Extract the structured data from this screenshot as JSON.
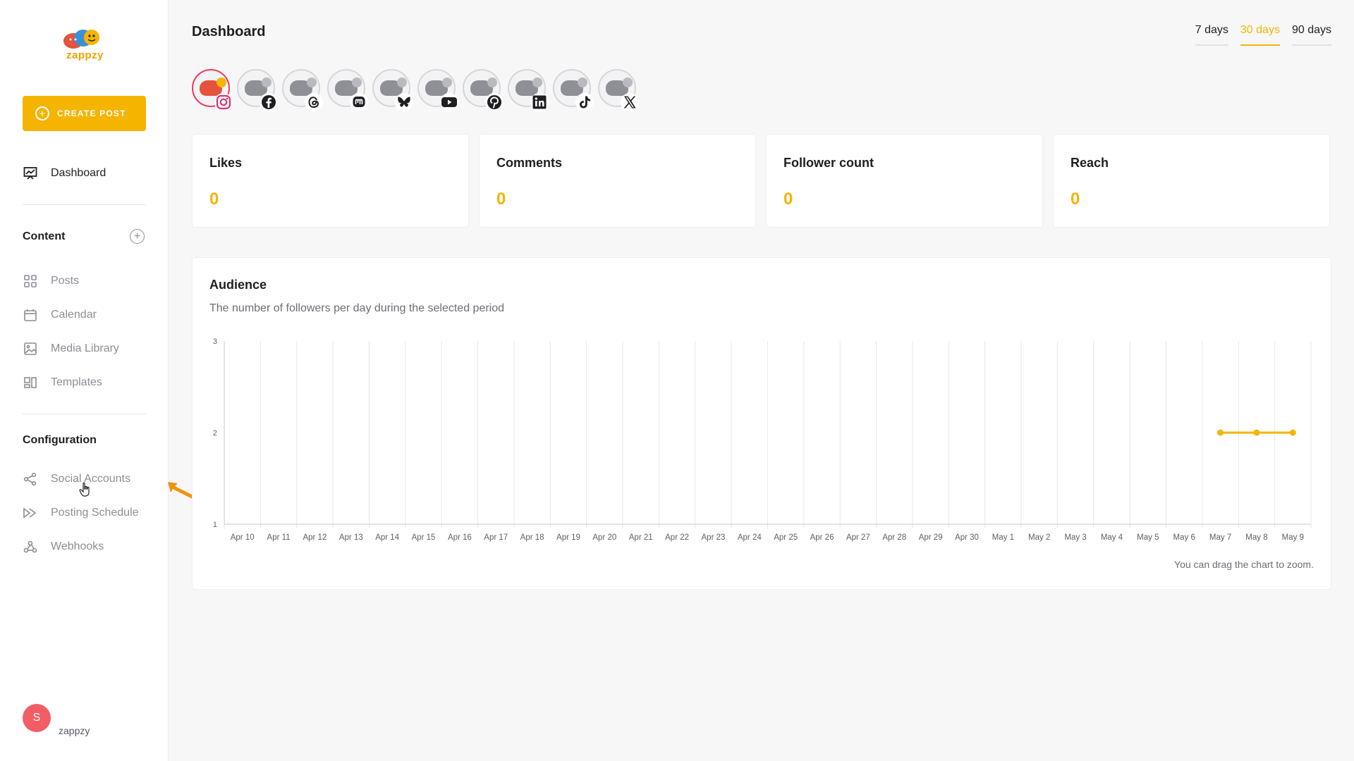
{
  "brand": {
    "name": "zappzy",
    "accent": "#f5b400"
  },
  "sidebar": {
    "create_label": "CREATE POST",
    "dashboard_label": "Dashboard",
    "content_title": "Content",
    "content_items": [
      {
        "label": "Posts",
        "icon": "grid-icon"
      },
      {
        "label": "Calendar",
        "icon": "calendar-icon"
      },
      {
        "label": "Media Library",
        "icon": "image-icon"
      },
      {
        "label": "Templates",
        "icon": "templates-icon"
      }
    ],
    "config_title": "Configuration",
    "config_items": [
      {
        "label": "Social Accounts",
        "icon": "share-icon"
      },
      {
        "label": "Posting Schedule",
        "icon": "schedule-icon"
      },
      {
        "label": "Webhooks",
        "icon": "webhook-icon"
      }
    ],
    "user": {
      "initial": "S",
      "name": "zappzy"
    }
  },
  "header": {
    "title": "Dashboard",
    "ranges": [
      "7 days",
      "30 days",
      "90 days"
    ],
    "selected_range": "30 days"
  },
  "accounts": [
    {
      "network": "instagram-icon",
      "active": true
    },
    {
      "network": "facebook-icon",
      "active": false
    },
    {
      "network": "threads-icon",
      "active": false
    },
    {
      "network": "mastodon-icon",
      "active": false
    },
    {
      "network": "bluesky-icon",
      "active": false
    },
    {
      "network": "youtube-icon",
      "active": false
    },
    {
      "network": "pinterest-icon",
      "active": false
    },
    {
      "network": "linkedin-icon",
      "active": false
    },
    {
      "network": "tiktok-icon",
      "active": false
    },
    {
      "network": "x-icon",
      "active": false
    }
  ],
  "stats": [
    {
      "title": "Likes",
      "value": "0"
    },
    {
      "title": "Comments",
      "value": "0"
    },
    {
      "title": "Follower count",
      "value": "0"
    },
    {
      "title": "Reach",
      "value": "0"
    }
  ],
  "audience": {
    "title": "Audience",
    "subtitle": "The number of followers per day during the selected period",
    "hint": "You can drag the chart to zoom."
  },
  "chart_data": {
    "type": "line",
    "title": "Audience",
    "categories": [
      "Apr 10",
      "Apr 11",
      "Apr 12",
      "Apr 13",
      "Apr 14",
      "Apr 15",
      "Apr 16",
      "Apr 17",
      "Apr 18",
      "Apr 19",
      "Apr 20",
      "Apr 21",
      "Apr 22",
      "Apr 23",
      "Apr 24",
      "Apr 25",
      "Apr 26",
      "Apr 27",
      "Apr 28",
      "Apr 29",
      "Apr 30",
      "May 1",
      "May 2",
      "May 3",
      "May 4",
      "May 5",
      "May 6",
      "May 7",
      "May 8",
      "May 9"
    ],
    "series": [
      {
        "values": [
          null,
          null,
          null,
          null,
          null,
          null,
          null,
          null,
          null,
          null,
          null,
          null,
          null,
          null,
          null,
          null,
          null,
          null,
          null,
          null,
          null,
          null,
          null,
          null,
          null,
          null,
          null,
          2,
          2,
          2
        ]
      }
    ],
    "ylim": [
      1,
      3
    ],
    "yticks": [
      "1",
      "2",
      "3"
    ],
    "grid": true,
    "color": "#f5b400"
  }
}
